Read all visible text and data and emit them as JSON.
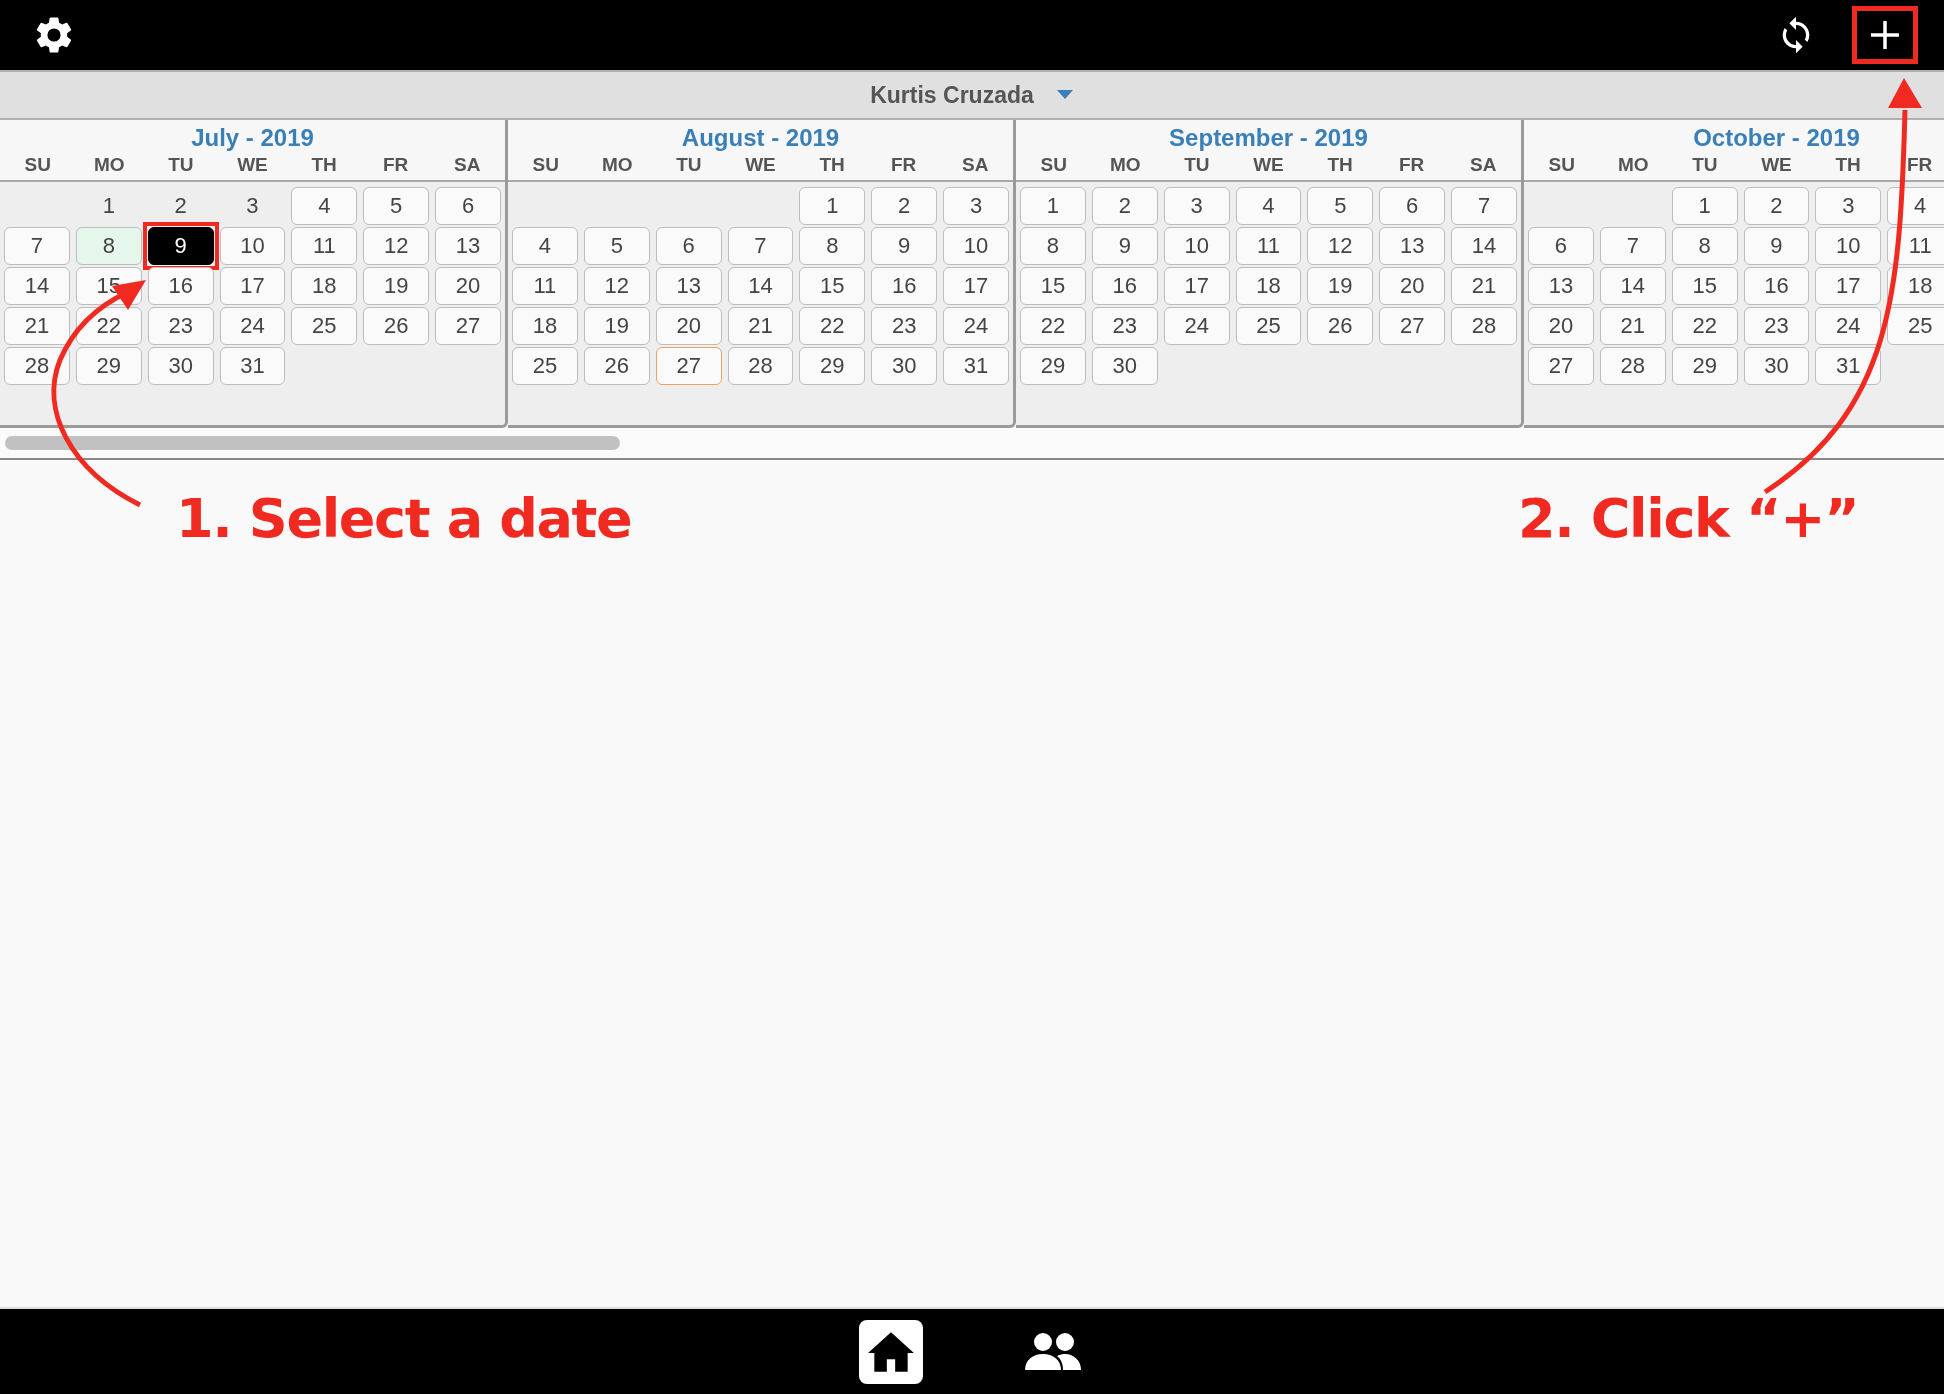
{
  "top_bar": {
    "add_highlighted": true
  },
  "header": {
    "user": "Kurtis Cruzada"
  },
  "months": [
    {
      "title": "July - 2019",
      "weekdays": [
        "SU",
        "MO",
        "TU",
        "WE",
        "TH",
        "FR",
        "SA"
      ],
      "weeks": [
        [
          {
            "kind": "blank"
          },
          {
            "day": "1",
            "kind": "plain",
            "selected": false
          },
          {
            "day": "2",
            "kind": "plain",
            "selected": false
          },
          {
            "day": "3",
            "kind": "plain",
            "selected": false
          },
          {
            "day": "4",
            "kind": "box",
            "selected": false
          },
          {
            "day": "5",
            "kind": "box",
            "selected": false
          },
          {
            "day": "6",
            "kind": "box",
            "selected": false
          }
        ],
        [
          {
            "day": "7",
            "kind": "box",
            "selected": false
          },
          {
            "day": "8",
            "kind": "today",
            "selected": false
          },
          {
            "day": "9",
            "kind": "box",
            "selected": true
          },
          {
            "day": "10",
            "kind": "box",
            "selected": false
          },
          {
            "day": "11",
            "kind": "box",
            "selected": false
          },
          {
            "day": "12",
            "kind": "box",
            "selected": false
          },
          {
            "day": "13",
            "kind": "box",
            "selected": false
          }
        ],
        [
          {
            "day": "14",
            "kind": "box",
            "selected": false
          },
          {
            "day": "15",
            "kind": "box",
            "selected": false
          },
          {
            "day": "16",
            "kind": "box",
            "selected": false
          },
          {
            "day": "17",
            "kind": "box",
            "selected": false
          },
          {
            "day": "18",
            "kind": "box",
            "selected": false
          },
          {
            "day": "19",
            "kind": "box",
            "selected": false
          },
          {
            "day": "20",
            "kind": "box",
            "selected": false
          }
        ],
        [
          {
            "day": "21",
            "kind": "box",
            "selected": false
          },
          {
            "day": "22",
            "kind": "box",
            "selected": false
          },
          {
            "day": "23",
            "kind": "box",
            "selected": false
          },
          {
            "day": "24",
            "kind": "box",
            "selected": false
          },
          {
            "day": "25",
            "kind": "box",
            "selected": false
          },
          {
            "day": "26",
            "kind": "box",
            "selected": false
          },
          {
            "day": "27",
            "kind": "box",
            "selected": false
          }
        ],
        [
          {
            "day": "28",
            "kind": "box",
            "selected": false
          },
          {
            "day": "29",
            "kind": "box",
            "selected": false
          },
          {
            "day": "30",
            "kind": "box",
            "selected": false
          },
          {
            "day": "31",
            "kind": "box",
            "selected": false
          }
        ]
      ]
    },
    {
      "title": "August - 2019",
      "weekdays": [
        "SU",
        "MO",
        "TU",
        "WE",
        "TH",
        "FR",
        "SA"
      ],
      "weeks": [
        [
          {
            "kind": "blank"
          },
          {
            "kind": "blank"
          },
          {
            "kind": "blank"
          },
          {
            "kind": "blank"
          },
          {
            "day": "1",
            "kind": "box",
            "selected": false
          },
          {
            "day": "2",
            "kind": "box",
            "selected": false
          },
          {
            "day": "3",
            "kind": "box",
            "selected": false
          }
        ],
        [
          {
            "day": "4",
            "kind": "box",
            "selected": false
          },
          {
            "day": "5",
            "kind": "box",
            "selected": false
          },
          {
            "day": "6",
            "kind": "box",
            "selected": false
          },
          {
            "day": "7",
            "kind": "box",
            "selected": false
          },
          {
            "day": "8",
            "kind": "box",
            "selected": false
          },
          {
            "day": "9",
            "kind": "box",
            "selected": false
          },
          {
            "day": "10",
            "kind": "box",
            "selected": false
          }
        ],
        [
          {
            "day": "11",
            "kind": "box",
            "selected": false
          },
          {
            "day": "12",
            "kind": "box",
            "selected": false
          },
          {
            "day": "13",
            "kind": "box",
            "selected": false
          },
          {
            "day": "14",
            "kind": "box",
            "selected": false
          },
          {
            "day": "15",
            "kind": "box",
            "selected": false
          },
          {
            "day": "16",
            "kind": "box",
            "selected": false
          },
          {
            "day": "17",
            "kind": "box",
            "selected": false
          }
        ],
        [
          {
            "day": "18",
            "kind": "box",
            "selected": false
          },
          {
            "day": "19",
            "kind": "box",
            "selected": false
          },
          {
            "day": "20",
            "kind": "box",
            "selected": false
          },
          {
            "day": "21",
            "kind": "box",
            "selected": false
          },
          {
            "day": "22",
            "kind": "box",
            "selected": false
          },
          {
            "day": "23",
            "kind": "box",
            "selected": false
          },
          {
            "day": "24",
            "kind": "box",
            "selected": false
          }
        ],
        [
          {
            "day": "25",
            "kind": "box",
            "selected": false
          },
          {
            "day": "26",
            "kind": "box",
            "selected": false
          },
          {
            "day": "27",
            "kind": "marked",
            "selected": false
          },
          {
            "day": "28",
            "kind": "box",
            "selected": false
          },
          {
            "day": "29",
            "kind": "box",
            "selected": false
          },
          {
            "day": "30",
            "kind": "box",
            "selected": false
          },
          {
            "day": "31",
            "kind": "box",
            "selected": false
          }
        ]
      ]
    },
    {
      "title": "September - 2019",
      "weekdays": [
        "SU",
        "MO",
        "TU",
        "WE",
        "TH",
        "FR",
        "SA"
      ],
      "weeks": [
        [
          {
            "day": "1",
            "kind": "box",
            "selected": false
          },
          {
            "day": "2",
            "kind": "box",
            "selected": false
          },
          {
            "day": "3",
            "kind": "box",
            "selected": false
          },
          {
            "day": "4",
            "kind": "box",
            "selected": false
          },
          {
            "day": "5",
            "kind": "box",
            "selected": false
          },
          {
            "day": "6",
            "kind": "box",
            "selected": false
          },
          {
            "day": "7",
            "kind": "box",
            "selected": false
          }
        ],
        [
          {
            "day": "8",
            "kind": "box",
            "selected": false
          },
          {
            "day": "9",
            "kind": "box",
            "selected": false
          },
          {
            "day": "10",
            "kind": "box",
            "selected": false
          },
          {
            "day": "11",
            "kind": "box",
            "selected": false
          },
          {
            "day": "12",
            "kind": "box",
            "selected": false
          },
          {
            "day": "13",
            "kind": "box",
            "selected": false
          },
          {
            "day": "14",
            "kind": "box",
            "selected": false
          }
        ],
        [
          {
            "day": "15",
            "kind": "box",
            "selected": false
          },
          {
            "day": "16",
            "kind": "box",
            "selected": false
          },
          {
            "day": "17",
            "kind": "box",
            "selected": false
          },
          {
            "day": "18",
            "kind": "box",
            "selected": false
          },
          {
            "day": "19",
            "kind": "box",
            "selected": false
          },
          {
            "day": "20",
            "kind": "box",
            "selected": false
          },
          {
            "day": "21",
            "kind": "box",
            "selected": false
          }
        ],
        [
          {
            "day": "22",
            "kind": "box",
            "selected": false
          },
          {
            "day": "23",
            "kind": "box",
            "selected": false
          },
          {
            "day": "24",
            "kind": "box",
            "selected": false
          },
          {
            "day": "25",
            "kind": "box",
            "selected": false
          },
          {
            "day": "26",
            "kind": "box",
            "selected": false
          },
          {
            "day": "27",
            "kind": "box",
            "selected": false
          },
          {
            "day": "28",
            "kind": "box",
            "selected": false
          }
        ],
        [
          {
            "day": "29",
            "kind": "box",
            "selected": false
          },
          {
            "day": "30",
            "kind": "box",
            "selected": false
          }
        ]
      ]
    },
    {
      "title": "October - 2019",
      "weekdays": [
        "SU",
        "MO",
        "TU",
        "WE",
        "TH",
        "FR"
      ],
      "weeks": [
        [
          {
            "kind": "blank"
          },
          {
            "kind": "blank"
          },
          {
            "day": "1",
            "kind": "box",
            "selected": false
          },
          {
            "day": "2",
            "kind": "box",
            "selected": false
          },
          {
            "day": "3",
            "kind": "box",
            "selected": false
          },
          {
            "day": "4",
            "kind": "box",
            "selected": false
          }
        ],
        [
          {
            "day": "6",
            "kind": "box",
            "selected": false
          },
          {
            "day": "7",
            "kind": "box",
            "selected": false
          },
          {
            "day": "8",
            "kind": "box",
            "selected": false
          },
          {
            "day": "9",
            "kind": "box",
            "selected": false
          },
          {
            "day": "10",
            "kind": "box",
            "selected": false
          },
          {
            "day": "11",
            "kind": "box",
            "selected": false
          }
        ],
        [
          {
            "day": "13",
            "kind": "box",
            "selected": false
          },
          {
            "day": "14",
            "kind": "box",
            "selected": false
          },
          {
            "day": "15",
            "kind": "box",
            "selected": false
          },
          {
            "day": "16",
            "kind": "box",
            "selected": false
          },
          {
            "day": "17",
            "kind": "box",
            "selected": false
          },
          {
            "day": "18",
            "kind": "box",
            "selected": false
          }
        ],
        [
          {
            "day": "20",
            "kind": "box",
            "selected": false
          },
          {
            "day": "21",
            "kind": "box",
            "selected": false
          },
          {
            "day": "22",
            "kind": "box",
            "selected": false
          },
          {
            "day": "23",
            "kind": "box",
            "selected": false
          },
          {
            "day": "24",
            "kind": "box",
            "selected": false
          },
          {
            "day": "25",
            "kind": "box",
            "selected": false
          }
        ],
        [
          {
            "day": "27",
            "kind": "box",
            "selected": false
          },
          {
            "day": "28",
            "kind": "box",
            "selected": false
          },
          {
            "day": "29",
            "kind": "box",
            "selected": false
          },
          {
            "day": "30",
            "kind": "box",
            "selected": false
          },
          {
            "day": "31",
            "kind": "box",
            "selected": false
          }
        ]
      ]
    }
  ],
  "annotations": [
    "1.  Select a date",
    "2. Click “+”"
  ],
  "bottom_bar": {
    "items": [
      {
        "kind": "home",
        "selected": true
      },
      {
        "kind": "people",
        "selected": false
      }
    ]
  }
}
